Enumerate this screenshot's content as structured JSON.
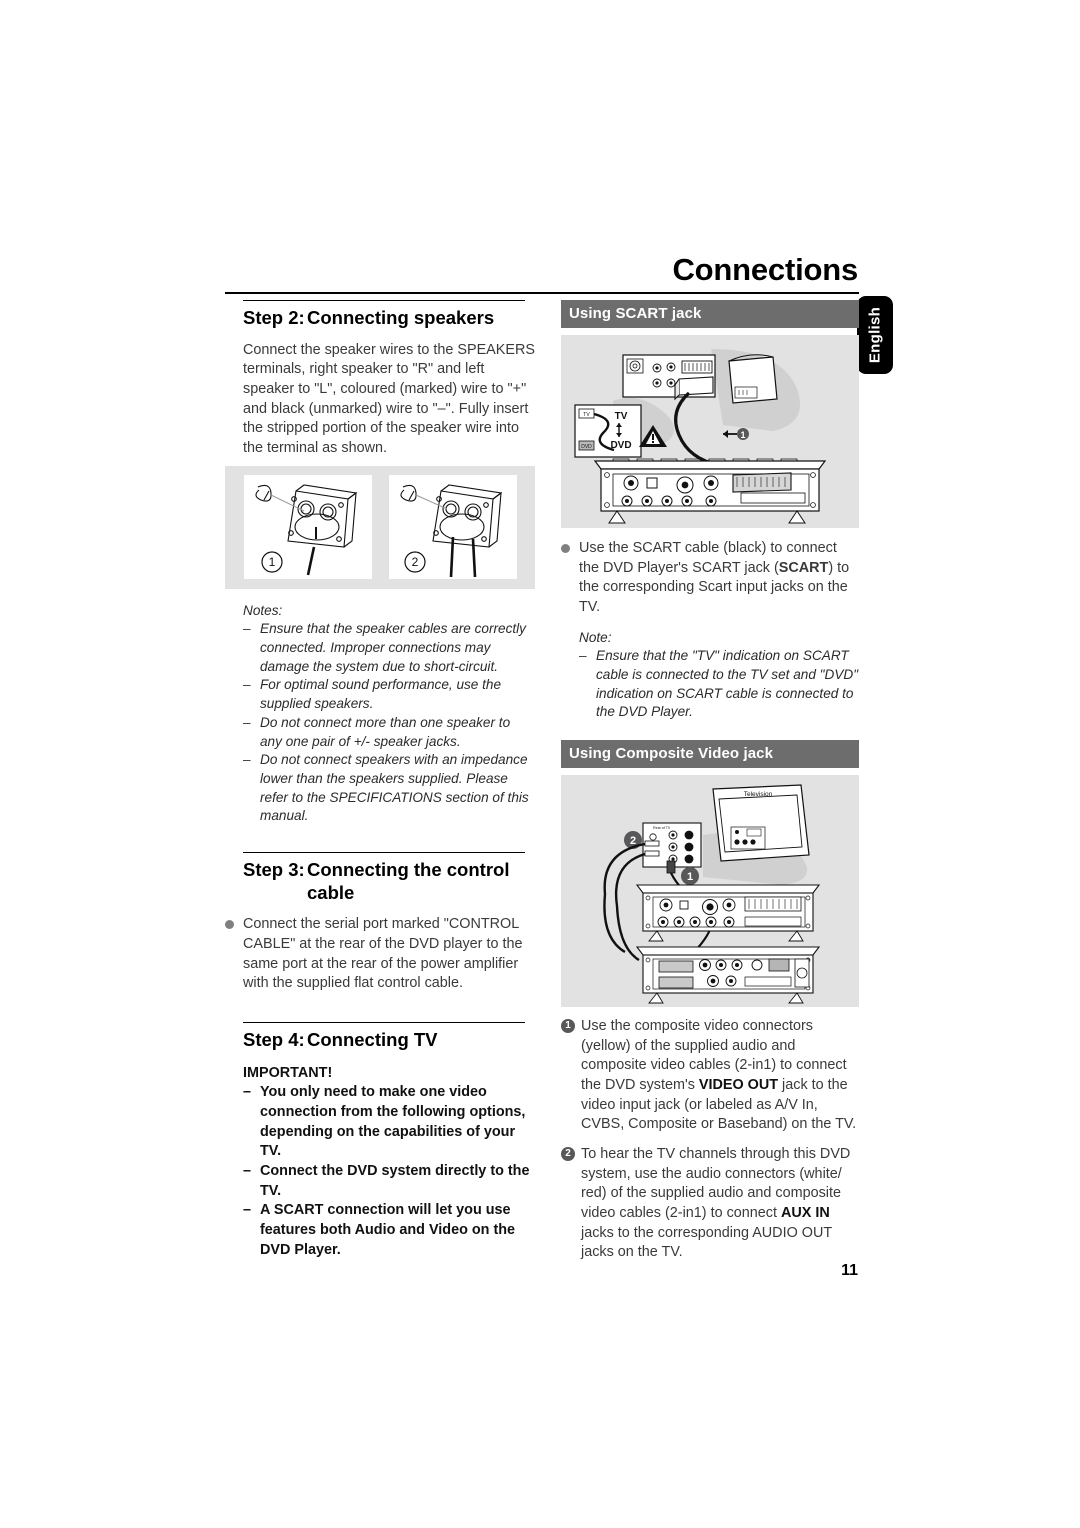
{
  "header": {
    "title": "Connections",
    "language_tab": "English",
    "page_number": "11"
  },
  "left_column": {
    "step2": {
      "number": "Step 2:",
      "title": "Connecting speakers",
      "paragraph": "Connect the speaker wires to the SPEAKERS terminals, right speaker to \"R\" and left speaker to \"L\", coloured (marked) wire to \"+\" and black (unmarked) wire to \"–\". Fully insert the stripped portion of the speaker wire into the terminal as shown.",
      "figure": {
        "caption_1": "1",
        "caption_2": "2",
        "alt": "two speaker terminal close-up diagrams"
      },
      "notes_label": "Notes:",
      "notes": [
        "Ensure that the speaker cables are correctly connected. Improper connections may damage the system due to short-circuit.",
        "For optimal sound performance, use the supplied speakers.",
        "Do not connect more than one speaker to any one pair of +/- speaker jacks.",
        "Do not connect speakers with an impedance lower than the speakers supplied. Please refer to the SPECIFICATIONS section of this manual."
      ]
    },
    "step3": {
      "number": "Step 3:",
      "title_line1": "Connecting the control",
      "title_line2": "cable",
      "bullet": "Connect the serial port marked \"CONTROL CABLE\" at the rear of the DVD player to the same port at the rear of the power amplifier with the supplied flat control cable."
    },
    "step4": {
      "number": "Step 4:",
      "title": "Connecting TV",
      "important_label": "IMPORTANT!",
      "important_items": [
        "You only need to make one video connection from the following options, depending on the capabilities of your TV.",
        "Connect the DVD system directly to the TV.",
        "A SCART connection will let you use features both Audio and Video on the DVD Player."
      ]
    }
  },
  "right_column": {
    "scart": {
      "bar_prefix": "Using ",
      "bar_bold": "SCART",
      "bar_suffix": " jack",
      "figure": {
        "label_tv": "TV",
        "label_dvd": "DVD",
        "callout_number": "1",
        "alt": "SCART cable connection between TV rear panel and DVD player rear panel"
      },
      "bullet_pre": "Use the SCART cable (black) to connect the DVD Player's SCART jack (",
      "bullet_bold": "SCART",
      "bullet_post": ") to the corresponding Scart input jacks on the TV.",
      "note_label": "Note:",
      "note": "Ensure that the \"TV\" indication on SCART cable is connected to the TV set and \"DVD\" indication on SCART cable is connected to the DVD Player."
    },
    "composite": {
      "bar_prefix": "Using ",
      "bar_bold": "Composite Video",
      "bar_suffix": " jack",
      "figure": {
        "tv_label": "Television",
        "marker_1": "1",
        "marker_2": "2",
        "alt": "composite video connection between TV and stacked DVD system rear panels"
      },
      "items": [
        {
          "number": "1",
          "pre": "Use the composite video connectors (yellow) of the supplied audio and composite video cables (2-in1) to connect the DVD system's ",
          "bold": "VIDEO OUT",
          "post": " jack to the video input jack (or labeled as A/V In, CVBS, Composite or Baseband) on the TV."
        },
        {
          "number": "2",
          "pre": "To hear the TV channels through this DVD system, use the audio connectors (white/ red) of the supplied audio and composite video cables (2-in1) to connect ",
          "bold": "AUX IN",
          "post": " jacks to the corresponding AUDIO OUT jacks on the TV."
        }
      ]
    }
  },
  "colors": {
    "section_bar": "#6d6d6d",
    "figure_bg": "#e2e2e2",
    "bullet": "#808080",
    "marker": "#58585a",
    "tab": "#000000"
  }
}
